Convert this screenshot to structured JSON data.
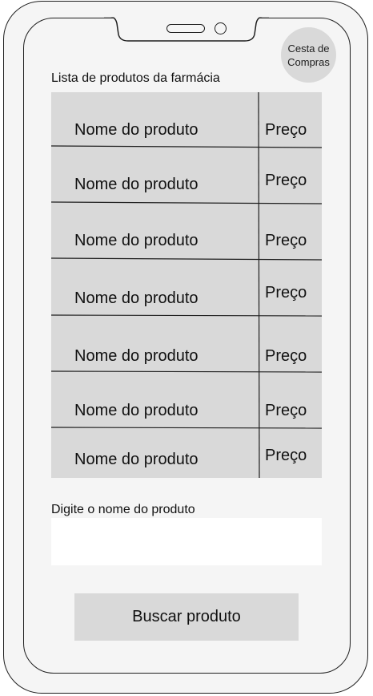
{
  "header": {
    "cart_label": "Cesta de\nCompras"
  },
  "products": {
    "title": "Lista de produtos da farmácia",
    "rows": [
      {
        "name": "Nome do produto",
        "price": "Preço"
      },
      {
        "name": "Nome do produto",
        "price": "Preço"
      },
      {
        "name": "Nome do produto",
        "price": "Preço"
      },
      {
        "name": "Nome do produto",
        "price": "Preço"
      },
      {
        "name": "Nome do produto",
        "price": "Preço"
      },
      {
        "name": "Nome do produto",
        "price": "Preço"
      },
      {
        "name": "Nome do produto",
        "price": "Preço"
      }
    ]
  },
  "search": {
    "label": "Digite o nome do produto",
    "value": "",
    "button_label": "Buscar produto"
  },
  "colors": {
    "background": "#f5f5f5",
    "cell": "#d9d9d9",
    "outline": "#1e1e1e",
    "input": "#ffffff"
  }
}
